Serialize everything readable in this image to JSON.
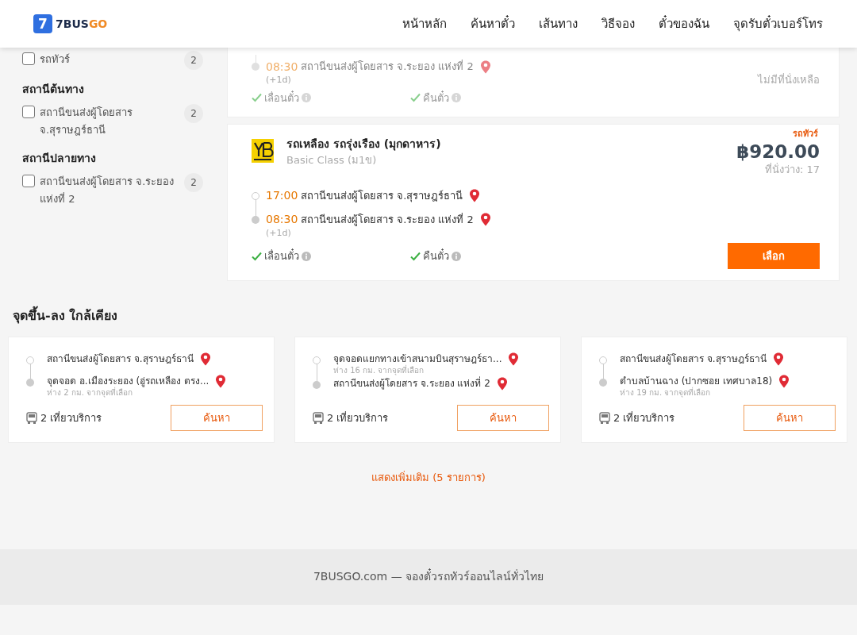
{
  "header": {
    "logo_mark": "7",
    "brand": "7BUS",
    "brand_accent": "GO",
    "nav": [
      {
        "label": "หน้าหลัก"
      },
      {
        "label": "ค้นหาตั๋ว"
      },
      {
        "label": "เส้นทาง"
      },
      {
        "label": "วิธีจอง"
      },
      {
        "label": "ตั๋วของฉัน"
      },
      {
        "label": "จุดรับตั๋วเบอร์โทร"
      }
    ]
  },
  "sidebar": {
    "groups": [
      {
        "options": [
          {
            "label": "รถทัวร์",
            "count": "2",
            "checked": false
          }
        ]
      },
      {
        "title": "สถานีต้นทาง",
        "options": [
          {
            "label": "สถานีขนส่งผู้โดยสาร จ.สุราษฎร์ธานี",
            "count": "2",
            "checked": false
          }
        ]
      },
      {
        "title": "สถานีปลายทาง",
        "options": [
          {
            "label": "สถานีขนส่งผู้โดยสาร จ.ระยอง แห่งที่ 2",
            "count": "2",
            "checked": false
          }
        ]
      }
    ]
  },
  "trips": [
    {
      "sold_out": true,
      "stops": [
        {
          "time": "08:30",
          "station": "สถานีขนส่งผู้โดยสาร จ.ระยอง แห่งที่ 2",
          "next_day": "(+1d)"
        }
      ],
      "features": [
        {
          "label": "เลื่อนตั๋ว",
          "available": true
        },
        {
          "label": "คืนตั๋ว",
          "available": true
        }
      ],
      "status": "ไม่มีที่นั่งเหลือ"
    },
    {
      "sold_out": false,
      "type_tag": "รถทัวร์",
      "operator": "รถเหลือง รถรุ่งเรือง (มุกดาหาร)",
      "bus_class": "Basic Class (ม1ข)",
      "price": "฿920.00",
      "seats": "ที่นั่งว่าง: 17",
      "stops": [
        {
          "time": "17:00",
          "station": "สถานีขนส่งผู้โดยสาร จ.สุราษฎร์ธานี"
        },
        {
          "time": "08:30",
          "station": "สถานีขนส่งผู้โดยสาร จ.ระยอง แห่งที่ 2",
          "next_day": "(+1d)"
        }
      ],
      "features": [
        {
          "label": "เลื่อนตั๋ว",
          "available": true
        },
        {
          "label": "คืนตั๋ว",
          "available": true
        }
      ],
      "button": "เลือก"
    }
  ],
  "nearby": {
    "title": "จุดขึ้น-ลง ใกล้เคียง",
    "cards": [
      {
        "from": {
          "name": "สถานีขนส่งผู้โดยสาร จ.สุราษฎร์ธานี"
        },
        "to": {
          "name": "จุดจอด อ.เมืองระยอง (อู่รถเหลือง ตรง...",
          "distance": "ห่าง 2 กม. จากจุดที่เลือก"
        },
        "trips": "2 เที่ยวบริการ",
        "button": "ค้นหา"
      },
      {
        "from": {
          "name": "จุดจอดแยกทางเข้าสนามบินสุราษฎร์ธา...",
          "distance": "ห่าง 16 กม. จากจุดที่เลือก"
        },
        "to": {
          "name": "สถานีขนส่งผู้โดยสาร จ.ระยอง แห่งที่ 2"
        },
        "trips": "2 เที่ยวบริการ",
        "button": "ค้นหา"
      },
      {
        "from": {
          "name": "สถานีขนส่งผู้โดยสาร จ.สุราษฎร์ธานี"
        },
        "to": {
          "name": "ตำบลบ้านฉาง (ปากซอย เทศบาล18)",
          "distance": "ห่าง 19 กม. จากจุดที่เลือก"
        },
        "trips": "2 เที่ยวบริการ",
        "button": "ค้นหา"
      }
    ],
    "more_link": "แสดงเพิ่มเติม (5 รายการ)"
  },
  "footer": {
    "text": "7BUSGO.com — จองตั๋วรถทัวร์ออนไลน์ทั่วไทย"
  }
}
